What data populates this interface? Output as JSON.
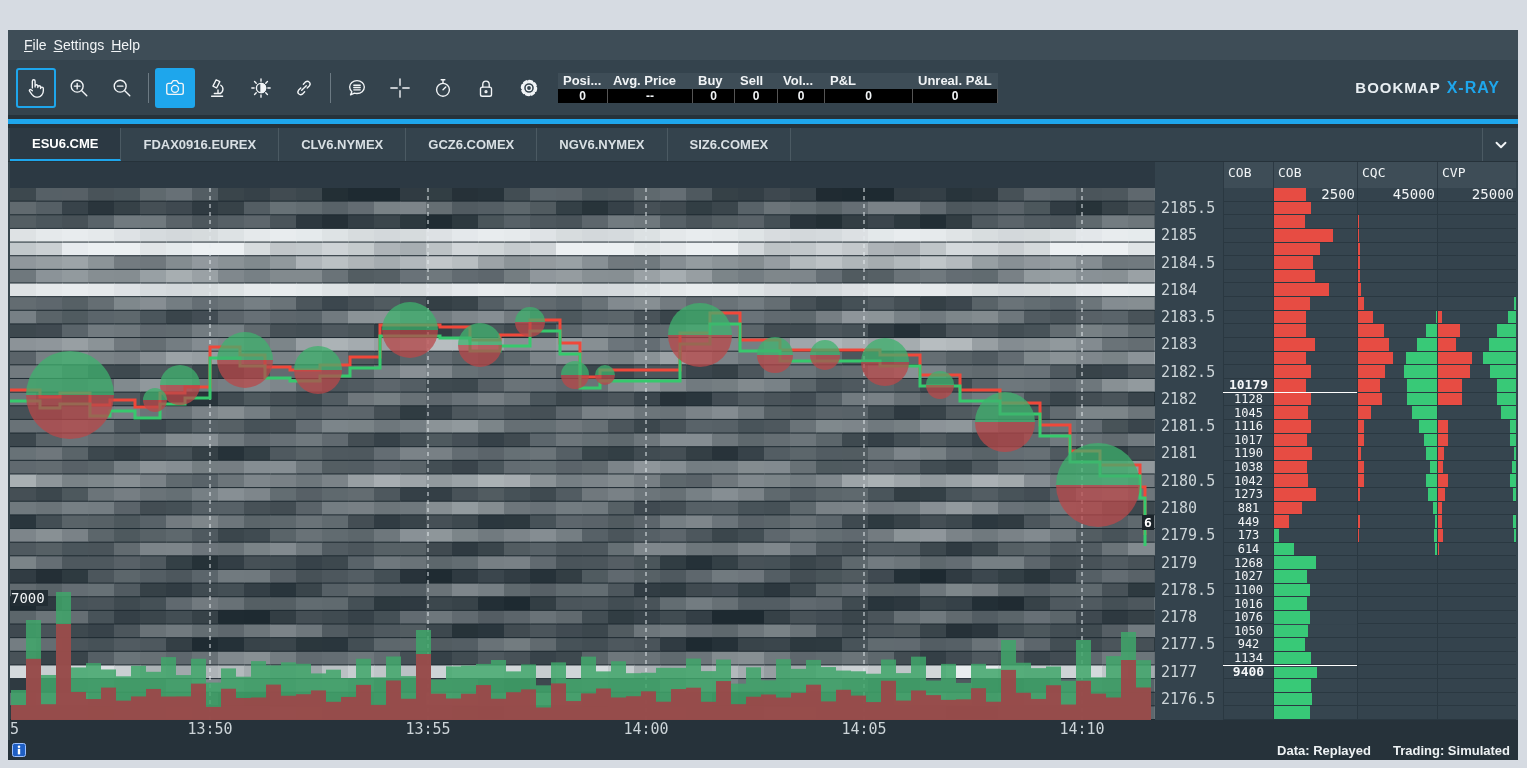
{
  "menu": [
    "File",
    "Settings",
    "Help"
  ],
  "toolbar": {
    "tool_groups": [
      [
        {
          "selected": false,
          "focused": true
        },
        {
          "selected": false,
          "focused": false
        },
        {
          "selected": false,
          "focused": false
        }
      ],
      [
        {
          "selected": true,
          "focused": false
        },
        {
          "selected": false,
          "focused": false
        },
        {
          "selected": false,
          "focused": false
        },
        {
          "selected": false,
          "focused": false
        }
      ],
      [
        {
          "selected": false,
          "focused": false
        },
        {
          "selected": false,
          "focused": false
        },
        {
          "selected": false,
          "focused": false
        },
        {
          "selected": false,
          "focused": false
        },
        {
          "selected": false,
          "focused": false
        }
      ]
    ],
    "stats": [
      {
        "header": "Posi...",
        "value": "0"
      },
      {
        "header": "Avg. Price",
        "value": "--"
      },
      {
        "header": "Buy",
        "value": "0"
      },
      {
        "header": "Sell",
        "value": "0"
      },
      {
        "header": "Vol...",
        "value": "0"
      },
      {
        "header": "P&L",
        "value": "0"
      },
      {
        "header": "Unreal. P&L",
        "value": "0"
      }
    ],
    "brand": {
      "name": "BOOKMAP",
      "product": "X-RAY"
    }
  },
  "tabs": [
    {
      "label": "ESU6.CME",
      "selected": true
    },
    {
      "label": "FDAX0916.EUREX",
      "selected": false
    },
    {
      "label": "CLV6.NYMEX",
      "selected": false
    },
    {
      "label": "GCZ6.COMEX",
      "selected": false
    },
    {
      "label": "NGV6.NYMEX",
      "selected": false
    },
    {
      "label": "SIZ6.COMEX",
      "selected": false
    }
  ],
  "chart": {
    "volume_scale": "7000",
    "last_trade_size": "6",
    "time_labels": [
      "5",
      "13:50",
      "13:55",
      "14:00",
      "14:05",
      "14:10"
    ]
  },
  "ladder": {
    "headers": [
      "COB",
      "COB",
      "CQC",
      "CVP"
    ],
    "scales": [
      "2500",
      "45000",
      "25000"
    ],
    "rows": [
      {
        "bars": [
          {
            "kind": "cob-ask",
            "level": 0.38
          }
        ]
      },
      {
        "price": "2185.5",
        "bars": [
          {
            "kind": "cob-ask",
            "level": 0.45
          }
        ]
      },
      {
        "bars": [
          {
            "kind": "cob-ask",
            "level": 0.37
          },
          {
            "kind": "cqc-sell",
            "level": 0.01
          }
        ]
      },
      {
        "price": "2185",
        "bars": [
          {
            "kind": "cob-ask",
            "level": 0.71
          },
          {
            "kind": "cqc-sell",
            "level": 0.01
          }
        ]
      },
      {
        "bars": [
          {
            "kind": "cob-ask",
            "level": 0.55
          },
          {
            "kind": "cqc-sell",
            "level": 0.02
          }
        ]
      },
      {
        "price": "2184.5",
        "bars": [
          {
            "kind": "cob-ask",
            "level": 0.47
          },
          {
            "kind": "cqc-sell",
            "level": 0.02
          }
        ]
      },
      {
        "bars": [
          {
            "kind": "cob-ask",
            "level": 0.49
          },
          {
            "kind": "cqc-sell",
            "level": 0.03
          }
        ]
      },
      {
        "price": "2184",
        "bars": [
          {
            "kind": "cob-ask",
            "level": 0.66
          },
          {
            "kind": "cqc-sell",
            "level": 0.04
          }
        ]
      },
      {
        "bars": [
          {
            "kind": "cob-ask",
            "level": 0.43
          },
          {
            "kind": "cqc-sell",
            "level": 0.07
          },
          {
            "kind": "cvp-buy",
            "level": 0.03
          }
        ]
      },
      {
        "price": "2183.5",
        "bars": [
          {
            "kind": "cob-ask",
            "level": 0.38
          },
          {
            "kind": "cqc-sell",
            "level": 0.19
          },
          {
            "kind": "cqc-buy",
            "level": 0.01
          },
          {
            "kind": "cvp-sell",
            "level": 0.05
          },
          {
            "kind": "cvp-buy",
            "level": 0.1
          }
        ]
      },
      {
        "bars": [
          {
            "kind": "cob-ask",
            "level": 0.38
          },
          {
            "kind": "cqc-sell",
            "level": 0.33
          },
          {
            "kind": "cqc-buy",
            "level": 0.14
          },
          {
            "kind": "cvp-sell",
            "level": 0.28
          },
          {
            "kind": "cvp-buy",
            "level": 0.25
          }
        ]
      },
      {
        "price": "2183",
        "bars": [
          {
            "kind": "cob-ask",
            "level": 0.49
          },
          {
            "kind": "cqc-sell",
            "level": 0.39
          },
          {
            "kind": "cqc-buy",
            "level": 0.25
          },
          {
            "kind": "cvp-sell",
            "level": 0.23
          },
          {
            "kind": "cvp-buy",
            "level": 0.34
          }
        ]
      },
      {
        "bars": [
          {
            "kind": "cob-ask",
            "level": 0.39
          },
          {
            "kind": "cqc-sell",
            "level": 0.44
          },
          {
            "kind": "cqc-buy",
            "level": 0.39
          },
          {
            "kind": "cvp-sell",
            "level": 0.43
          },
          {
            "kind": "cvp-buy",
            "level": 0.42
          }
        ]
      },
      {
        "price": "2182.5",
        "bars": [
          {
            "kind": "cob-ask",
            "level": 0.44
          },
          {
            "kind": "cqc-sell",
            "level": 0.34
          },
          {
            "kind": "cqc-buy",
            "level": 0.42
          },
          {
            "kind": "cvp-sell",
            "level": 0.41
          },
          {
            "kind": "cvp-buy",
            "level": 0.33
          }
        ]
      },
      {
        "cob": "10179",
        "cob_bold": true,
        "bars": [
          {
            "kind": "cob-ask",
            "level": 0.39
          },
          {
            "kind": "cqc-sell",
            "level": 0.28
          },
          {
            "kind": "cqc-buy",
            "level": 0.38
          },
          {
            "kind": "cvp-sell",
            "level": 0.31
          },
          {
            "kind": "cvp-buy",
            "level": 0.24
          }
        ]
      },
      {
        "price": "2182",
        "cob": "1128",
        "cob_bold": false,
        "bars": [
          {
            "kind": "cob-ask",
            "level": 0.44
          },
          {
            "kind": "cqc-sell",
            "level": 0.31
          },
          {
            "kind": "cqc-buy",
            "level": 0.38
          },
          {
            "kind": "cvp-sell",
            "level": 0.31
          },
          {
            "kind": "cvp-buy",
            "level": 0.24
          }
        ]
      },
      {
        "cob": "1045",
        "cob_bold": false,
        "bars": [
          {
            "kind": "cob-ask",
            "level": 0.41
          },
          {
            "kind": "cqc-sell",
            "level": 0.17
          },
          {
            "kind": "cqc-buy",
            "level": 0.32
          },
          {
            "kind": "cvp-buy",
            "level": 0.19
          }
        ]
      },
      {
        "price": "2181.5",
        "cob": "1116",
        "cob_bold": false,
        "bars": [
          {
            "kind": "cob-ask",
            "level": 0.44
          },
          {
            "kind": "cqc-sell",
            "level": 0.07
          },
          {
            "kind": "cqc-buy",
            "level": 0.23
          },
          {
            "kind": "cvp-sell",
            "level": 0.13
          },
          {
            "kind": "cvp-buy",
            "level": 0.08
          }
        ]
      },
      {
        "cob": "1017",
        "cob_bold": false,
        "bars": [
          {
            "kind": "cob-ask",
            "level": 0.4
          },
          {
            "kind": "cqc-sell",
            "level": 0.07
          },
          {
            "kind": "cqc-buy",
            "level": 0.17
          },
          {
            "kind": "cvp-sell",
            "level": 0.13
          },
          {
            "kind": "cvp-buy",
            "level": 0.08
          }
        ]
      },
      {
        "price": "2181",
        "cob": "1190",
        "cob_bold": false,
        "bars": [
          {
            "kind": "cob-ask",
            "level": 0.46
          },
          {
            "kind": "cqc-sell",
            "level": 0.04
          },
          {
            "kind": "cqc-buy",
            "level": 0.14
          },
          {
            "kind": "cvp-sell",
            "level": 0.08
          },
          {
            "kind": "cvp-buy",
            "level": 0.03
          }
        ]
      },
      {
        "cob": "1038",
        "cob_bold": false,
        "bars": [
          {
            "kind": "cob-ask",
            "level": 0.4
          },
          {
            "kind": "cqc-sell",
            "level": 0.07
          },
          {
            "kind": "cqc-buy",
            "level": 0.09
          },
          {
            "kind": "cvp-sell",
            "level": 0.06
          },
          {
            "kind": "cvp-buy",
            "level": 0.05
          }
        ]
      },
      {
        "price": "2180.5",
        "cob": "1042",
        "cob_bold": false,
        "bars": [
          {
            "kind": "cob-ask",
            "level": 0.41
          },
          {
            "kind": "cqc-sell",
            "level": 0.08
          },
          {
            "kind": "cqc-buy",
            "level": 0.14
          },
          {
            "kind": "cvp-sell",
            "level": 0.13
          },
          {
            "kind": "cvp-buy",
            "level": 0.08
          }
        ]
      },
      {
        "cob": "1273",
        "cob_bold": false,
        "bars": [
          {
            "kind": "cob-ask",
            "level": 0.5
          },
          {
            "kind": "cqc-sell",
            "level": 0.03
          },
          {
            "kind": "cqc-buy",
            "level": 0.11
          },
          {
            "kind": "cvp-sell",
            "level": 0.09
          },
          {
            "kind": "cvp-buy",
            "level": 0.04
          }
        ]
      },
      {
        "price": "2180",
        "cob": "881",
        "cob_bold": false,
        "bars": [
          {
            "kind": "cob-ask",
            "level": 0.34
          },
          {
            "kind": "cqc-buy",
            "level": 0.05
          },
          {
            "kind": "cvp-sell",
            "level": 0.05
          }
        ]
      },
      {
        "cob": "449",
        "cob_bold": false,
        "bars": [
          {
            "kind": "cob-ask",
            "level": 0.18
          },
          {
            "kind": "cqc-sell",
            "level": 0.03
          },
          {
            "kind": "cqc-buy",
            "level": 0.03
          },
          {
            "kind": "cvp-sell",
            "level": 0.05
          },
          {
            "kind": "cvp-buy",
            "level": 0.04
          }
        ]
      },
      {
        "price": "2179.5",
        "cob": "173",
        "cob_bold": false,
        "bars": [
          {
            "kind": "cob-bid",
            "level": 0.06
          },
          {
            "kind": "cqc-sell",
            "level": 0.01
          },
          {
            "kind": "cqc-buy",
            "level": 0.04
          },
          {
            "kind": "cvp-sell",
            "level": 0.06
          },
          {
            "kind": "cvp-buy",
            "level": 0.03
          }
        ]
      },
      {
        "cob": "614",
        "cob_bold": false,
        "bars": [
          {
            "kind": "cob-bid",
            "level": 0.24
          },
          {
            "kind": "cqc-buy",
            "level": 0.03
          },
          {
            "kind": "cvp-sell",
            "level": 0.01
          }
        ]
      },
      {
        "price": "2179",
        "cob": "1268",
        "cob_bold": false,
        "bars": [
          {
            "kind": "cob-bid",
            "level": 0.5
          }
        ]
      },
      {
        "cob": "1027",
        "cob_bold": false,
        "bars": [
          {
            "kind": "cob-bid",
            "level": 0.4
          }
        ]
      },
      {
        "price": "2178.5",
        "cob": "1100",
        "cob_bold": false,
        "bars": [
          {
            "kind": "cob-bid",
            "level": 0.43
          }
        ]
      },
      {
        "cob": "1016",
        "cob_bold": false,
        "bars": [
          {
            "kind": "cob-bid",
            "level": 0.4
          }
        ]
      },
      {
        "price": "2178",
        "cob": "1076",
        "cob_bold": false,
        "bars": [
          {
            "kind": "cob-bid",
            "level": 0.43
          }
        ]
      },
      {
        "cob": "1050",
        "cob_bold": false,
        "bars": [
          {
            "kind": "cob-bid",
            "level": 0.41
          }
        ]
      },
      {
        "price": "2177.5",
        "cob": "942",
        "cob_bold": false,
        "bars": [
          {
            "kind": "cob-bid",
            "level": 0.37
          }
        ]
      },
      {
        "cob": "1134",
        "cob_bold": false,
        "bars": [
          {
            "kind": "cob-bid",
            "level": 0.45
          }
        ]
      },
      {
        "price": "2177",
        "cob": "9400",
        "cob_bold": true,
        "bars": [
          {
            "kind": "cob-bid",
            "level": 0.52
          }
        ]
      },
      {
        "bars": [
          {
            "kind": "cob-bid",
            "level": 0.45
          }
        ]
      },
      {
        "price": "2176.5",
        "bars": [
          {
            "kind": "cob-bid",
            "level": 0.46
          }
        ]
      },
      {
        "bars": [
          {
            "kind": "cob-bid",
            "level": 0.43
          }
        ]
      }
    ]
  },
  "status_bar": {
    "data_mode": "Data: Replayed",
    "trading_mode": "Trading: Simulated"
  }
}
